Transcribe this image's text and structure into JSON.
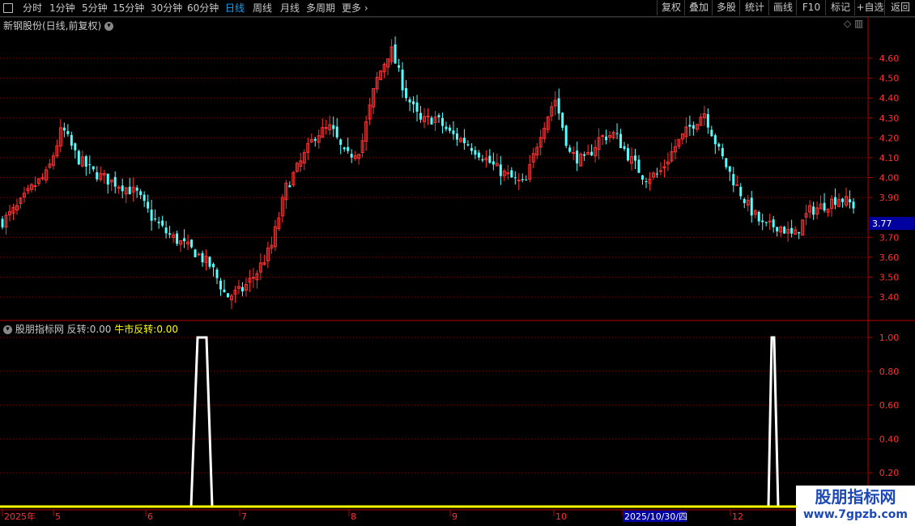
{
  "toolbar": {
    "periods": [
      "分时",
      "1分钟",
      "5分钟",
      "15分钟",
      "30分钟",
      "60分钟",
      "日线",
      "周线",
      "月线",
      "多周期",
      "更多"
    ],
    "active_period": "日线",
    "right_buttons": [
      "复权",
      "叠加",
      "多股",
      "统计",
      "画线",
      "F10",
      "标记",
      "+自选",
      "返回"
    ]
  },
  "main_panel": {
    "title": "新钢股份(日线,前复权)",
    "price_ticks": [
      "4.60",
      "4.50",
      "4.40",
      "4.30",
      "4.20",
      "4.10",
      "4.00",
      "3.90",
      "3.70",
      "3.60",
      "3.50",
      "3.40"
    ],
    "current_price": "3.77"
  },
  "indicator_panel": {
    "name": "股朋指标网",
    "series": [
      {
        "label": "反转:",
        "value": "0.00"
      },
      {
        "label": "牛市反转:",
        "value": "0.00"
      }
    ],
    "ticks": [
      "1.00",
      "0.80",
      "0.60",
      "0.40",
      "0.20"
    ]
  },
  "time_axis": {
    "labels": [
      "2025年",
      "5",
      "6",
      "7",
      "8",
      "9",
      "10",
      "2025/10/30/四",
      "12"
    ]
  },
  "watermark": {
    "name": "股朋指标网",
    "url": "www.7gpzb.com"
  },
  "colors": {
    "up": "#ff3232",
    "down": "#54ffff",
    "grid": "#8a0000",
    "axis": "#b40000",
    "signal": "#ffffff",
    "bull_signal": "#ffff00",
    "price_tag_bg": "#0000a0"
  },
  "chart_data": {
    "type": "candlestick",
    "title": "新钢股份(日线,前复权)",
    "ylim": [
      3.35,
      4.7
    ],
    "x_period_labels": [
      "2025年",
      "5",
      "6",
      "7",
      "8",
      "9",
      "10",
      "2025/10/30/四",
      "12"
    ],
    "close_trend": [
      3.78,
      3.85,
      3.95,
      4.02,
      4.25,
      4.1,
      4.03,
      3.99,
      3.96,
      3.92,
      3.8,
      3.72,
      3.67,
      3.62,
      3.55,
      3.4,
      3.43,
      3.52,
      3.65,
      3.95,
      4.08,
      4.22,
      4.25,
      4.1,
      4.15,
      4.48,
      4.65,
      4.42,
      4.28,
      4.3,
      4.22,
      4.18,
      4.12,
      4.05,
      4.0,
      3.96,
      4.22,
      4.4,
      4.12,
      4.08,
      4.2,
      4.22,
      4.1,
      4.0,
      4.02,
      4.15,
      4.25,
      4.33,
      4.13,
      3.98,
      3.85,
      3.75,
      3.76,
      3.7,
      3.83,
      3.86,
      3.9,
      3.86
    ],
    "indicator": {
      "series": [
        {
          "name": "反转",
          "pulse_at": [
            "6",
            "12"
          ],
          "max": 1.0
        },
        {
          "name": "牛市反转",
          "value": 0.0
        }
      ],
      "ylim": [
        0,
        1.05
      ]
    }
  }
}
